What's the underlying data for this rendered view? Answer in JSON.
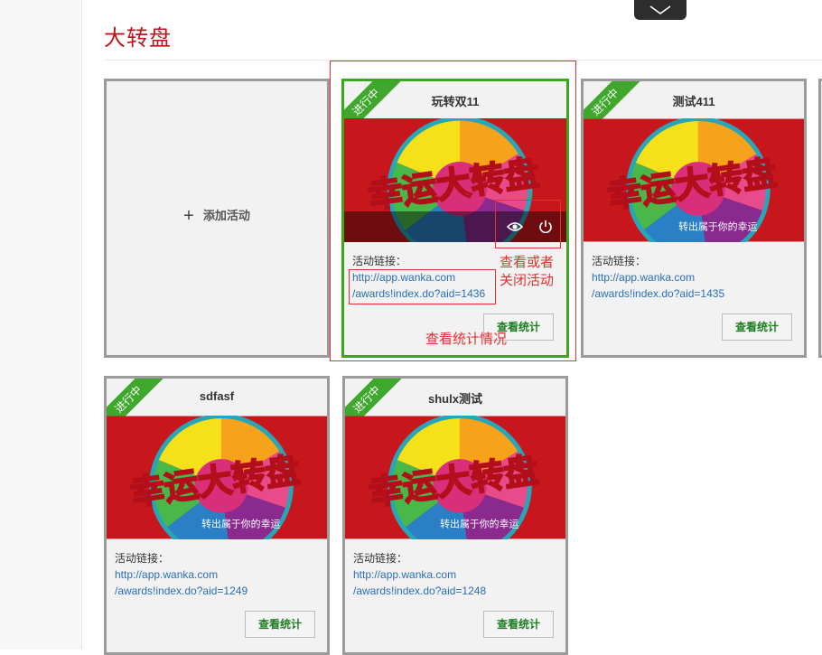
{
  "page": {
    "title": "大转盘"
  },
  "add_card": {
    "label": "添加活动"
  },
  "banner_text": "幸运大转盘",
  "banner_sub": "转出属于你的幸运",
  "cards": [
    {
      "name": "玩转双11",
      "status": "进行中",
      "link_label": "活动链接：",
      "link_line1": "http://app.wanka.com",
      "link_line2": "/awards!index.do?aid=1436",
      "button": "查看统计",
      "active": true
    },
    {
      "name": "测试411",
      "status": "进行中",
      "link_label": "活动链接：",
      "link_line1": "http://app.wanka.com",
      "link_line2": "/awards!index.do?aid=1435",
      "button": "查看统计",
      "active": false
    },
    {
      "name": "sdfasf",
      "status": "进行中",
      "link_label": "活动链接：",
      "link_line1": "http://app.wanka.com",
      "link_line2": "/awards!index.do?aid=1249",
      "button": "查看统计",
      "active": false
    },
    {
      "name": "shulx测试",
      "status": "进行中",
      "link_label": "活动链接：",
      "link_line1": "http://app.wanka.com",
      "link_line2": "/awards!index.do?aid=1248",
      "button": "查看统计",
      "active": false
    }
  ],
  "annotations": {
    "view_or_close_line1": "查看或者",
    "view_or_close_line2": "关闭活动",
    "view_stats": "查看统计情况"
  },
  "icons": {
    "collapse": "chevron-down-icon",
    "add": "plus-icon",
    "view": "eye-icon",
    "close": "power-icon"
  },
  "colors": {
    "title_red": "#b8171d",
    "status_green": "#3fa82c",
    "link_blue": "#2a6ebb",
    "annotation_red": "#e23030",
    "button_text": "#1e7e23"
  }
}
